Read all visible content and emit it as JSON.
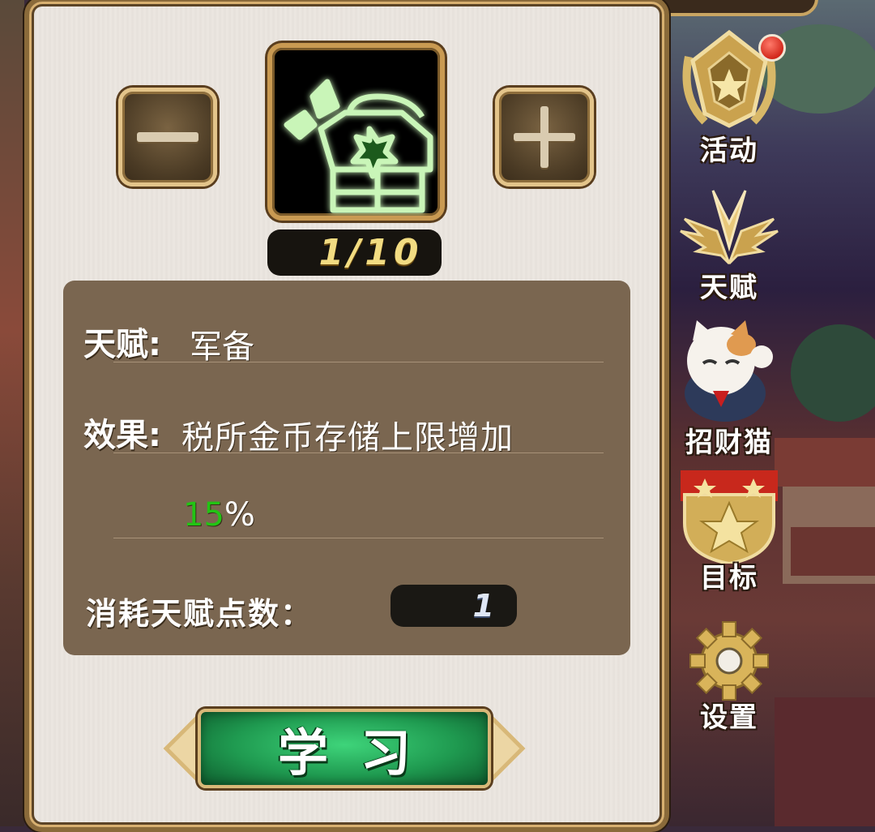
{
  "skill": {
    "level_text": "1/10",
    "icon": "treasure-chest-icon"
  },
  "info": {
    "talent_label": "天赋:",
    "talent_value": "军备",
    "effect_label": "效果:",
    "effect_value": "税所金币存储上限增加",
    "effect_percent_number": "15",
    "effect_percent_sign": "%",
    "cost_label": "消耗天赋点数：",
    "cost_value": "1"
  },
  "learn_button": {
    "label": "学习"
  },
  "side_menu": {
    "items": [
      {
        "label": "活动",
        "icon": "medal-icon"
      },
      {
        "label": "天赋",
        "icon": "wings-emblem-icon"
      },
      {
        "label": "招财猫",
        "icon": "lucky-cat-icon"
      },
      {
        "label": "目标",
        "icon": "star-shield-icon"
      },
      {
        "label": "设置",
        "icon": "gear-icon"
      }
    ]
  },
  "colors": {
    "accent_green": "#22c414",
    "panel_bg": "#ebe6df",
    "info_bg": "#7a6650",
    "gold_border": "#c99a52"
  }
}
